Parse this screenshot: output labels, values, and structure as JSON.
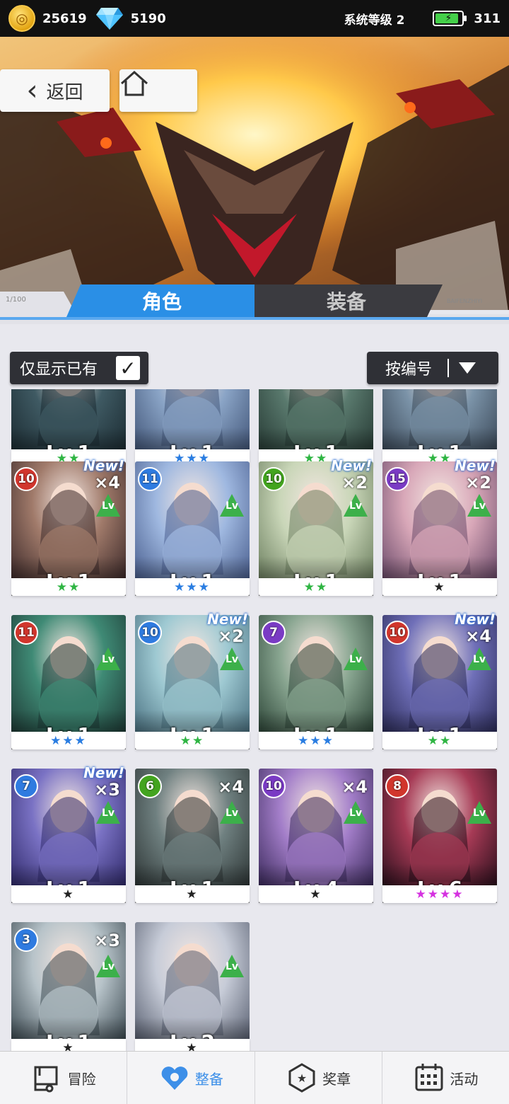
{
  "topbar": {
    "coin_value": "25619",
    "coin_icon": "coin-icon",
    "gem_value": "5190",
    "gem_icon": "diamond-icon",
    "system_level": "系统等级 2",
    "energy_value": "311"
  },
  "nav": {
    "back_label": "返回"
  },
  "tabs": [
    {
      "label": "角色",
      "active": true
    },
    {
      "label": "装备",
      "active": false
    }
  ],
  "filters": {
    "owned_only_label": "仅显示已有",
    "owned_only_checked": true,
    "sort_label": "按编号"
  },
  "colors": {
    "accent_blue": "#3d8fe8",
    "star_green": "#2fb543",
    "star_blue": "#2a7de1",
    "star_black": "#222222",
    "star_purple": "#d531e0",
    "badge_red": "#d1362d",
    "badge_blue": "#2f7be0",
    "badge_green": "#43a41f",
    "badge_purple": "#7a3bc4"
  },
  "cards": [
    {
      "level": "Lv.1",
      "stars": "★★",
      "star_color": "#2fb543"
    },
    {
      "level": "Lv.1",
      "stars": "★★★",
      "star_color": "#2a7de1"
    },
    {
      "level": "Lv.1",
      "stars": "★★",
      "star_color": "#2fb543"
    },
    {
      "level": "Lv.1",
      "stars": "★★",
      "star_color": "#2fb543"
    },
    {
      "badge": "10",
      "badge_color": "#d1362d",
      "new": "New!",
      "mult": "×4",
      "lv_icon": "Lv",
      "level": "Lv.1",
      "stars": "★★",
      "star_color": "#2fb543"
    },
    {
      "badge": "11",
      "badge_color": "#2f7be0",
      "lv_icon": "Lv",
      "level": "Lv.1",
      "stars": "★★★",
      "star_color": "#2a7de1"
    },
    {
      "badge": "10",
      "badge_color": "#43a41f",
      "new": "New!",
      "mult": "×2",
      "lv_icon": "Lv",
      "level": "Lv.1",
      "stars": "★★",
      "star_color": "#2fb543"
    },
    {
      "badge": "15",
      "badge_color": "#7a3bc4",
      "new": "New!",
      "mult": "×2",
      "lv_icon": "Lv",
      "level": "Lv.1",
      "stars": "★",
      "star_color": "#222222"
    },
    {
      "badge": "11",
      "badge_color": "#d1362d",
      "lv_icon": "Lv",
      "level": "Lv.1",
      "stars": "★★★",
      "star_color": "#2a7de1"
    },
    {
      "badge": "10",
      "badge_color": "#2f7be0",
      "new": "New!",
      "mult": "×2",
      "lv_icon": "Lv",
      "level": "Lv.1",
      "stars": "★★",
      "star_color": "#2fb543"
    },
    {
      "badge": "7",
      "badge_color": "#7a3bc4",
      "lv_icon": "Lv",
      "level": "Lv.1",
      "stars": "★★★",
      "star_color": "#2a7de1"
    },
    {
      "badge": "10",
      "badge_color": "#d1362d",
      "new": "New!",
      "mult": "×4",
      "lv_icon": "Lv",
      "level": "Lv.1",
      "stars": "★★",
      "star_color": "#2fb543"
    },
    {
      "badge": "7",
      "badge_color": "#2f7be0",
      "new": "New!",
      "mult": "×3",
      "lv_icon": "Lv",
      "level": "Lv.1",
      "stars": "★",
      "star_color": "#222222"
    },
    {
      "badge": "6",
      "badge_color": "#43a41f",
      "mult": "×4",
      "lv_icon": "Lv",
      "level": "Lv.1",
      "stars": "★",
      "star_color": "#222222"
    },
    {
      "badge": "10",
      "badge_color": "#7a3bc4",
      "mult": "×4",
      "lv_icon": "Lv",
      "level": "Lv.4",
      "stars": "★",
      "star_color": "#222222"
    },
    {
      "badge": "8",
      "badge_color": "#d1362d",
      "lv_icon": "Lv",
      "level": "Lv.6",
      "stars": "★★★★",
      "star_color": "#d531e0"
    },
    {
      "badge": "3",
      "badge_color": "#2f7be0",
      "mult": "×3",
      "lv_icon": "Lv",
      "level": "Lv.1",
      "stars": "★",
      "star_color": "#222222"
    },
    {
      "lv_icon": "Lv",
      "level": "Lv.2",
      "stars": "★",
      "star_color": "#222222"
    }
  ],
  "bottom_nav": [
    {
      "label": "冒险",
      "icon": "truck-icon",
      "active": false
    },
    {
      "label": "整备",
      "icon": "heart-gear-icon",
      "active": true
    },
    {
      "label": "奖章",
      "icon": "medal-icon",
      "active": false
    },
    {
      "label": "活动",
      "icon": "calendar-icon",
      "active": false
    }
  ]
}
